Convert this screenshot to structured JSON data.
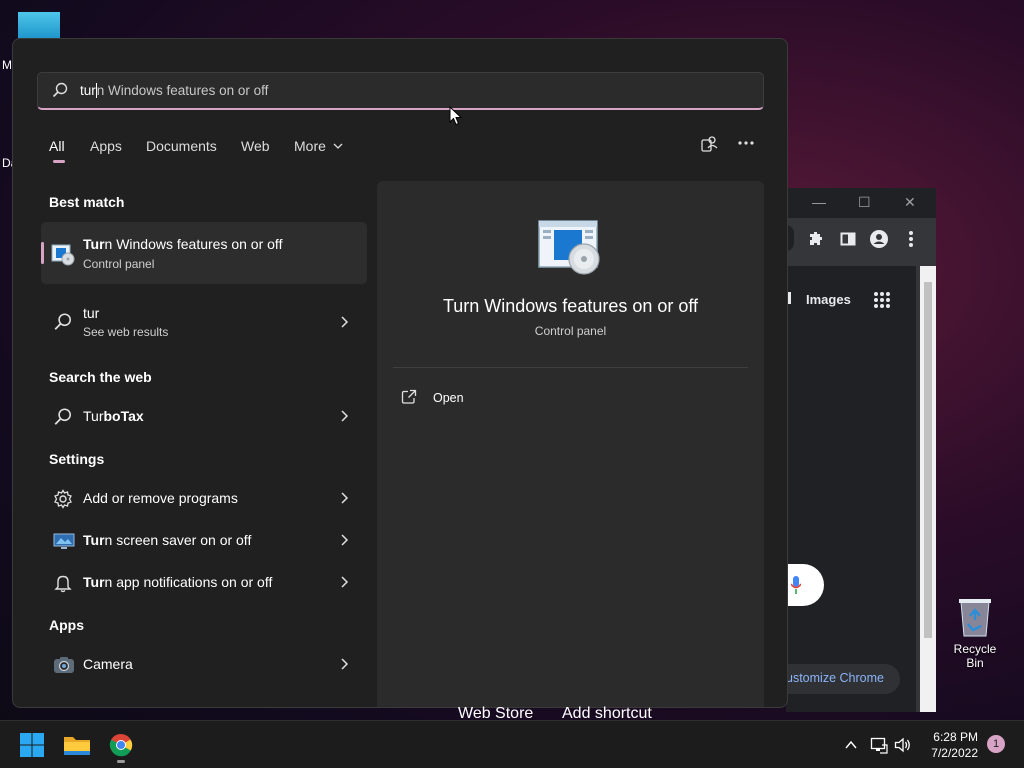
{
  "desktop": {
    "fragment_m": "M",
    "fragment_da": "Da",
    "recycle_bin_label": "Recycle Bin"
  },
  "chrome": {
    "images_link": "Images",
    "customize_label": "ustomize Chrome",
    "web_store": "Web Store",
    "add_shortcut": "Add shortcut",
    "minimize": "—",
    "maximize": "☐",
    "close": "✕"
  },
  "search": {
    "typed": "tur",
    "completion": "n Windows features on or off"
  },
  "tabs": [
    {
      "label": "All"
    },
    {
      "label": "Apps"
    },
    {
      "label": "Documents"
    },
    {
      "label": "Web"
    },
    {
      "label": "More"
    }
  ],
  "sections": {
    "best_match": "Best match",
    "search_web": "Search the web",
    "settings": "Settings",
    "apps": "Apps"
  },
  "results": {
    "best": {
      "bold": "Tur",
      "rest": "n Windows features on or off",
      "sub": "Control panel"
    },
    "web_tur": {
      "title": "tur",
      "sub": "See web results"
    },
    "turbotax": {
      "bold": "Tur",
      "rest": "boTax"
    },
    "add_remove": {
      "title": "Add or remove programs"
    },
    "screen_saver": {
      "bold": "Tur",
      "rest": "n screen saver on or off"
    },
    "notifications": {
      "bold": "Tur",
      "rest": "n app notifications on or off"
    },
    "camera": {
      "title": "Camera"
    }
  },
  "detail": {
    "title": "Turn Windows features on or off",
    "subtitle": "Control panel",
    "open_label": "Open"
  },
  "taskbar": {
    "time": "6:28 PM",
    "date": "7/2/2022",
    "notification_count": "1"
  },
  "colors": {
    "accent": "#d8a4c6",
    "panel_bg": "#202020",
    "detail_bg": "#2b2b2b"
  }
}
